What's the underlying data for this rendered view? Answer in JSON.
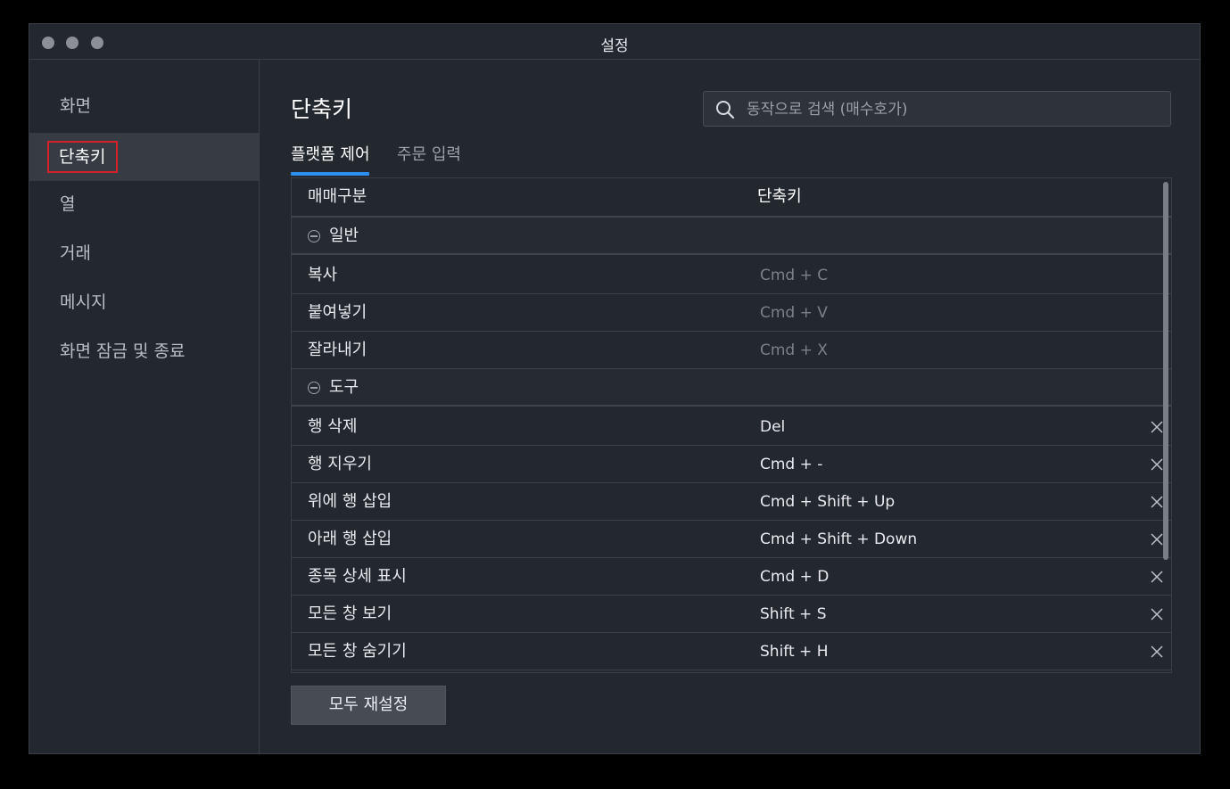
{
  "window": {
    "title": "설정"
  },
  "sidebar": {
    "items": [
      {
        "label": "화면"
      },
      {
        "label": "단축키",
        "active": true
      },
      {
        "label": "열"
      },
      {
        "label": "거래"
      },
      {
        "label": "메시지"
      },
      {
        "label": "화면 잠금 및 종료"
      }
    ]
  },
  "main": {
    "title": "단축키",
    "search": {
      "placeholder": "동작으로 검색 (매수호가)",
      "value": ""
    },
    "tabs": [
      {
        "label": "플랫폼 제어",
        "active": true
      },
      {
        "label": "주문 입력"
      }
    ],
    "table": {
      "headers": [
        "매매구분",
        "단축키"
      ],
      "rows": [
        {
          "type": "group",
          "label": "일반"
        },
        {
          "type": "item",
          "action": "복사",
          "shortcut": "Cmd + C",
          "editable": false
        },
        {
          "type": "item",
          "action": "붙여넣기",
          "shortcut": "Cmd + V",
          "editable": false
        },
        {
          "type": "item",
          "action": "잘라내기",
          "shortcut": "Cmd + X",
          "editable": false
        },
        {
          "type": "group",
          "label": "도구"
        },
        {
          "type": "item",
          "action": "행 삭제",
          "shortcut": "Del",
          "editable": true
        },
        {
          "type": "item",
          "action": "행 지우기",
          "shortcut": "Cmd + -",
          "editable": true
        },
        {
          "type": "item",
          "action": "위에 행 삽입",
          "shortcut": "Cmd + Shift + Up",
          "editable": true
        },
        {
          "type": "item",
          "action": "아래 행 삽입",
          "shortcut": "Cmd + Shift + Down",
          "editable": true
        },
        {
          "type": "item",
          "action": "종목 상세 표시",
          "shortcut": "Cmd + D",
          "editable": true
        },
        {
          "type": "item",
          "action": "모든 창 보기",
          "shortcut": "Shift + S",
          "editable": true
        },
        {
          "type": "item",
          "action": "모든 창 숨기기",
          "shortcut": "Shift + H",
          "editable": true
        }
      ]
    },
    "reset_label": "모두 재설정"
  },
  "colors": {
    "accent": "#2f8ff0",
    "highlight": "#d3222a",
    "background": "#23272e"
  }
}
